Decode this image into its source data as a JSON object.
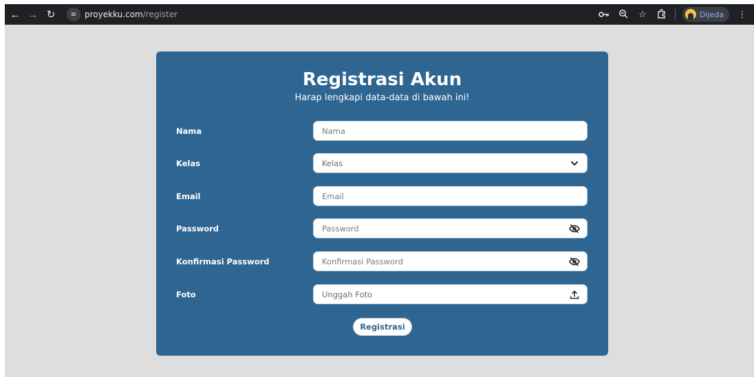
{
  "browser": {
    "url_host": "proyekku.com",
    "url_path": "/register",
    "profile_name": "Dijeda"
  },
  "form": {
    "title": "Registrasi Akun",
    "subtitle": "Harap lengkapi data-data di bawah ini!",
    "fields": [
      {
        "label": "Nama",
        "placeholder": "Nama",
        "type": "text"
      },
      {
        "label": "Kelas",
        "placeholder": "Kelas",
        "type": "select"
      },
      {
        "label": "Email",
        "placeholder": "Email",
        "type": "email"
      },
      {
        "label": "Password",
        "placeholder": "Password",
        "type": "password"
      },
      {
        "label": "Konfirmasi Password",
        "placeholder": "Konfirmasi Password",
        "type": "password"
      },
      {
        "label": "Foto",
        "placeholder": "Unggah Foto",
        "type": "file"
      }
    ],
    "submit_label": "Registrasi"
  },
  "colors": {
    "card_bg": "#2e6591",
    "page_bg": "#dedede",
    "chrome_bg": "#202124"
  },
  "icons": {
    "back": "arrow-left-icon",
    "forward": "arrow-right-icon",
    "reload": "reload-icon",
    "site_info": "tune-icon",
    "password_manager": "key-icon",
    "zoom": "zoom-icon",
    "bookmark": "star-icon",
    "extensions": "puzzle-icon",
    "menu": "kebab-menu-icon",
    "select": "chevron-down-icon",
    "password_toggle": "eye-off-icon",
    "upload": "upload-icon"
  }
}
